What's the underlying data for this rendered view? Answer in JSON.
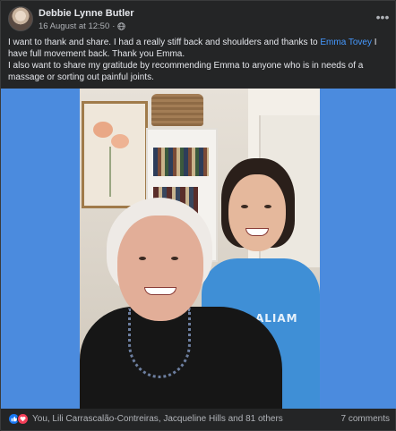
{
  "post": {
    "author": "Debbie Lynne Butler",
    "date": "16 August at 12:50",
    "dot": "·",
    "more_label": "•••",
    "text_part1": "I want to thank and share. I had a really stiff back and shoulders and thanks to ",
    "mention": "Emma Tovey",
    "text_part2": " I have full movement back. Thank you Emma.",
    "text_line2": "I also want to share my gratitude by recommending Emma to anyone who is in needs of a massage or sorting out painful joints.",
    "shirt_text": "ALIAM"
  },
  "footer": {
    "reactions_text": "You, Lili Carrascalão-Contreiras, Jacqueline Hills and 81 others",
    "comments": "7 comments"
  },
  "icons": {
    "privacy": "globe-icon",
    "more": "more-options-icon",
    "like": "like-icon",
    "love": "love-icon"
  },
  "colors": {
    "background": "#242526",
    "mention": "#4599ff",
    "photo_bg": "#4b8bde",
    "like": "#1877f2",
    "love": "#f33e58"
  }
}
